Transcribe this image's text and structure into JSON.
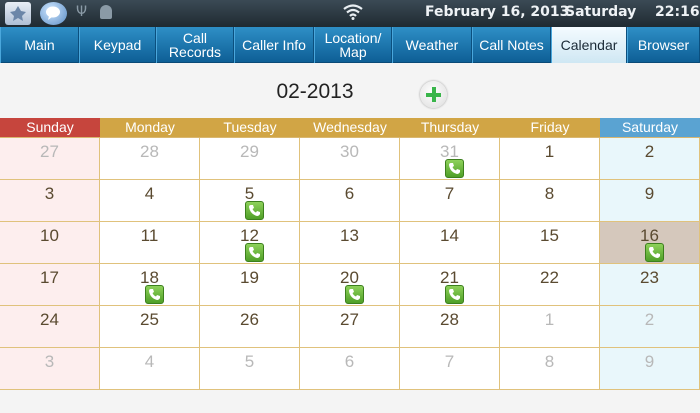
{
  "statusbar": {
    "date": "February 16, 2013",
    "day": "Saturday",
    "time": "22:16"
  },
  "tabs": [
    {
      "label": "Main",
      "active": false
    },
    {
      "label": "Keypad",
      "active": false
    },
    {
      "label": "Call\nRecords",
      "active": false
    },
    {
      "label": "Caller Info",
      "active": false
    },
    {
      "label": "Location/\nMap",
      "active": false
    },
    {
      "label": "Weather",
      "active": false
    },
    {
      "label": "Call Notes",
      "active": false
    },
    {
      "label": "Calendar",
      "active": true
    },
    {
      "label": "Browser",
      "active": false
    }
  ],
  "calendar": {
    "month_title": "02-2013",
    "weekdays": [
      "Sunday",
      "Monday",
      "Tuesday",
      "Wednesday",
      "Thursday",
      "Friday",
      "Saturday"
    ],
    "today": 16,
    "weeks": [
      [
        {
          "d": "27",
          "o": true
        },
        {
          "d": "28",
          "o": true
        },
        {
          "d": "29",
          "o": true
        },
        {
          "d": "30",
          "o": true
        },
        {
          "d": "31",
          "o": true,
          "call": true
        },
        {
          "d": "1"
        },
        {
          "d": "2"
        }
      ],
      [
        {
          "d": "3"
        },
        {
          "d": "4"
        },
        {
          "d": "5",
          "call": true
        },
        {
          "d": "6"
        },
        {
          "d": "7"
        },
        {
          "d": "8"
        },
        {
          "d": "9"
        }
      ],
      [
        {
          "d": "10"
        },
        {
          "d": "11"
        },
        {
          "d": "12",
          "call": true
        },
        {
          "d": "13"
        },
        {
          "d": "14"
        },
        {
          "d": "15"
        },
        {
          "d": "16",
          "call": true,
          "today": true
        }
      ],
      [
        {
          "d": "17"
        },
        {
          "d": "18",
          "call": true
        },
        {
          "d": "19"
        },
        {
          "d": "20",
          "call": true
        },
        {
          "d": "21",
          "call": true
        },
        {
          "d": "22"
        },
        {
          "d": "23"
        }
      ],
      [
        {
          "d": "24"
        },
        {
          "d": "25"
        },
        {
          "d": "26"
        },
        {
          "d": "27"
        },
        {
          "d": "28"
        },
        {
          "d": "1",
          "o": true
        },
        {
          "d": "2",
          "o": true
        }
      ],
      [
        {
          "d": "3",
          "o": true
        },
        {
          "d": "4",
          "o": true
        },
        {
          "d": "5",
          "o": true
        },
        {
          "d": "6",
          "o": true
        },
        {
          "d": "7",
          "o": true
        },
        {
          "d": "8",
          "o": true
        },
        {
          "d": "9",
          "o": true
        }
      ]
    ]
  },
  "colors": {
    "sunday_header": "#c6453d",
    "weekday_header": "#d1a545",
    "saturday_header": "#5aa3d2",
    "tabbar": "#1a74ad",
    "call_icon": "#6ab83a"
  },
  "icons": {
    "add": "plus-circle-icon",
    "call": "phone-icon"
  }
}
